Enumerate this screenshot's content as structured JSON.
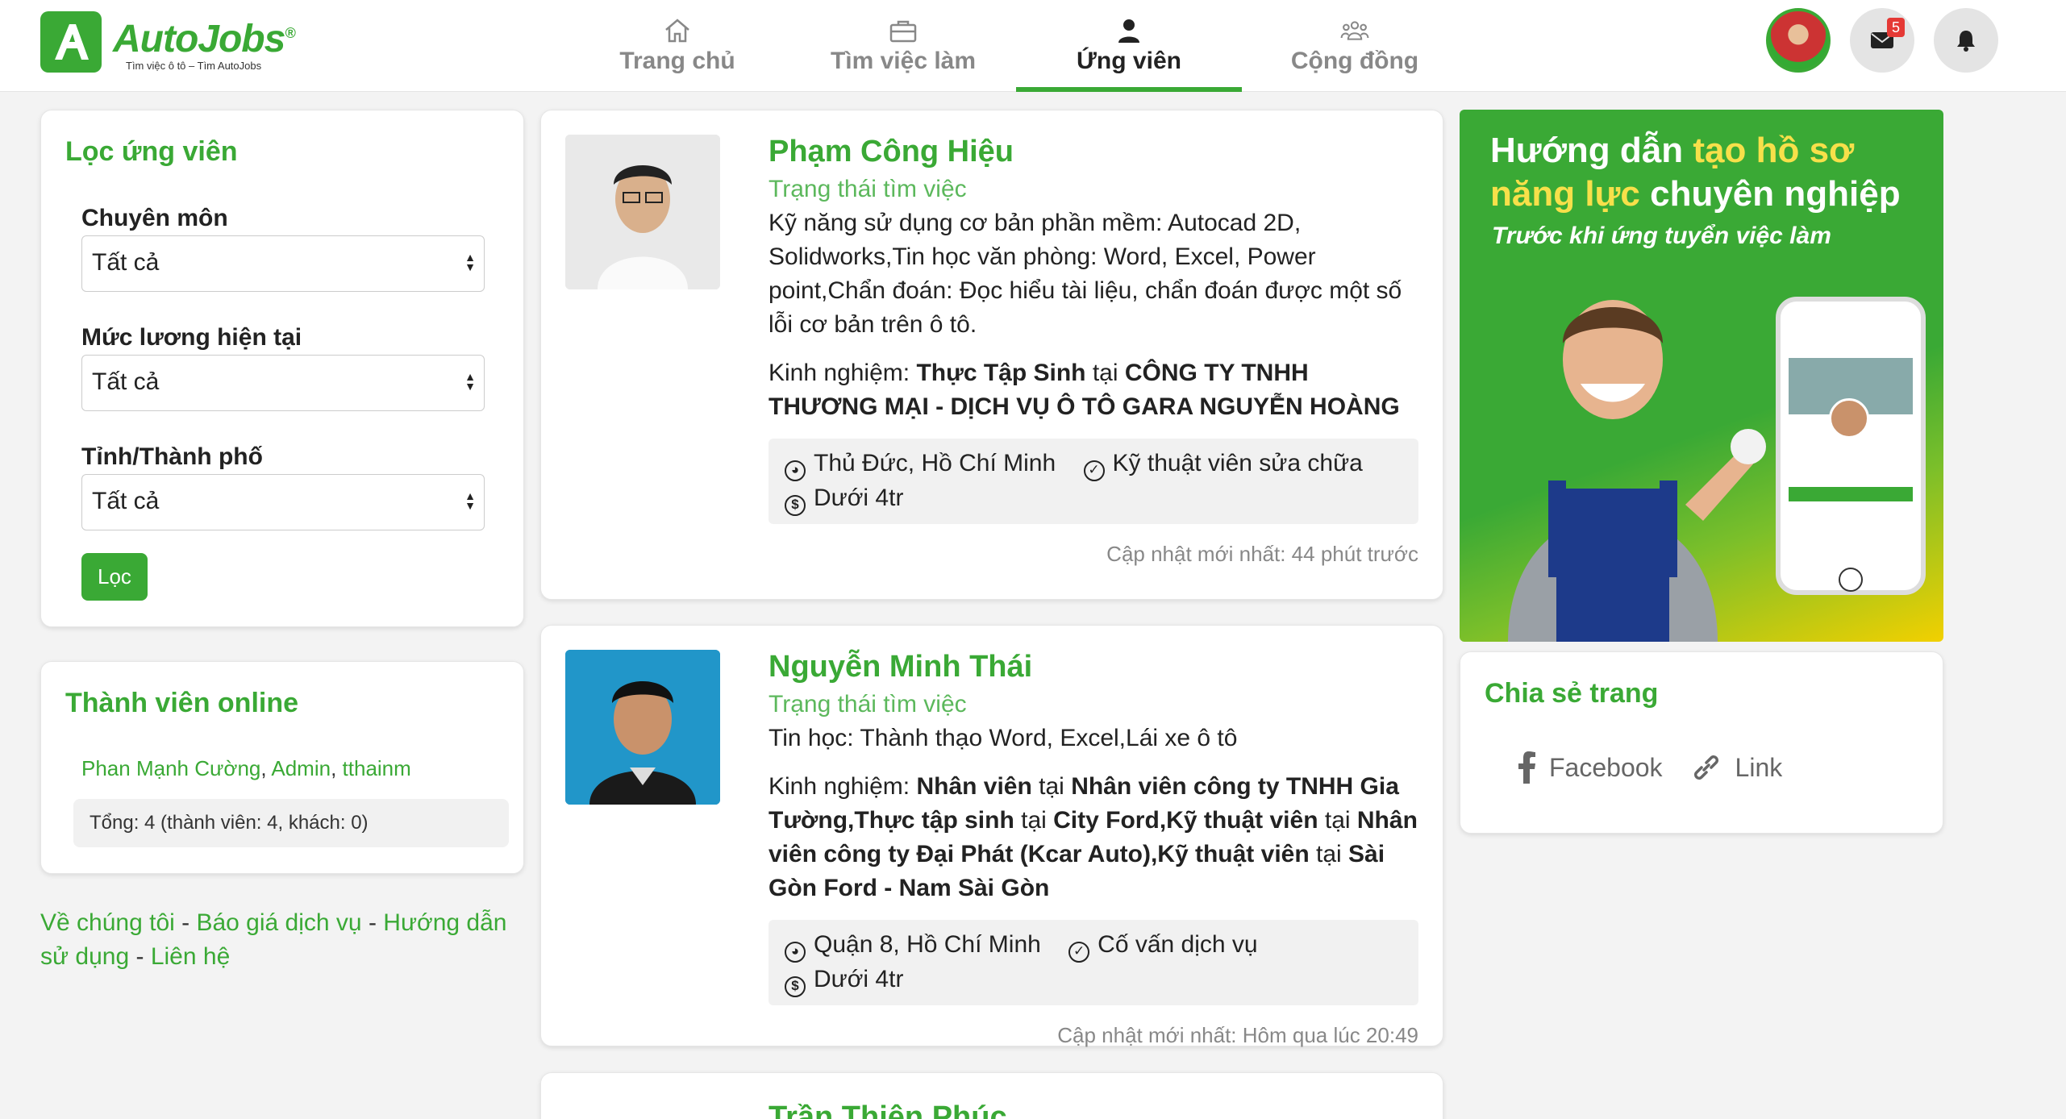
{
  "brand": {
    "name": "AutoJobs",
    "reg": "®",
    "tagline": "Tìm việc ô tô – Tìm AutoJobs"
  },
  "nav": [
    {
      "label": "Trang chủ",
      "icon": "home-icon"
    },
    {
      "label": "Tìm việc làm",
      "icon": "briefcase-icon"
    },
    {
      "label": "Ứng viên",
      "icon": "user-icon",
      "active": true
    },
    {
      "label": "Cộng đồng",
      "icon": "community-icon"
    }
  ],
  "header": {
    "message_badge": "5"
  },
  "filter": {
    "title": "Lọc ứng viên",
    "fields": [
      {
        "label": "Chuyên môn",
        "value": "Tất cả"
      },
      {
        "label": "Mức lương hiện tại",
        "value": "Tất cả"
      },
      {
        "label": "Tỉnh/Thành phố",
        "value": "Tất cả"
      }
    ],
    "button": "Lọc"
  },
  "online": {
    "title": "Thành viên online",
    "members": [
      "Phan Mạnh Cường",
      "Admin",
      "tthainm"
    ],
    "separator": ", ",
    "total": "Tổng: 4 (thành viên: 4, khách: 0)"
  },
  "footer": {
    "links": [
      "Về chúng tôi",
      "Báo giá dịch vụ",
      "Hướng dẫn sử dụng",
      "Liên hệ"
    ],
    "separator": " - "
  },
  "candidates": [
    {
      "name": "Phạm Công Hiệu",
      "status": "Trạng thái tìm việc",
      "desc": "Kỹ năng sử dụng cơ bản phần mềm: Autocad 2D, Solidworks,Tin học văn phòng: Word, Excel, Power point,Chẩn đoán: Đọc hiểu tài liệu, chẩn đoán được một số lỗi cơ bản trên ô tô.",
      "exp_prefix": "Kinh nghiệm: ",
      "exp_role": "Thực Tập Sinh",
      "exp_at": " tại ",
      "exp_company": "CÔNG TY TNHH THƯƠNG MẠI - DỊCH VỤ Ô TÔ GARA NGUYỄN HOÀNG",
      "location": "Thủ Đức, Hồ Chí Minh",
      "position": "Kỹ thuật viên sửa chữa",
      "salary": "Dưới 4tr",
      "updated": "Cập nhật mới nhất: 44 phút trước"
    },
    {
      "name": "Nguyễn Minh Thái",
      "status": "Trạng thái tìm việc",
      "desc": "Tin học: Thành thạo Word, Excel,Lái xe ô tô",
      "exp_prefix": "Kinh nghiệm: ",
      "exp_parts": [
        {
          "role": "Nhân viên",
          "at": " tại ",
          "company": "Nhân viên công ty TNHH Gia Tường"
        },
        {
          "role": "Thực tập sinh",
          "at": " tại ",
          "company": "City Ford"
        },
        {
          "role": "Kỹ thuật viên",
          "at": " tại ",
          "company": "Nhân viên công ty Đại Phát (Kcar Auto)"
        },
        {
          "role": "Kỹ thuật viên",
          "at": " tại ",
          "company": "Sài Gòn Ford - Nam Sài Gòn"
        }
      ],
      "location": "Quận 8, Hồ Chí Minh",
      "position": "Cố vấn dịch vụ",
      "salary": "Dưới 4tr",
      "updated": "Cập nhật mới nhất: Hôm qua lúc 20:49"
    },
    {
      "name": "Trần Thiện Phúc"
    }
  ],
  "promo": {
    "line1_a": "Hướng dẫn ",
    "line1_b": "tạo hồ sơ",
    "line2_a": "năng lực",
    "line2_b": " chuyên nghiệp",
    "subtitle": "Trước khi ứng tuyển việc làm"
  },
  "share": {
    "title": "Chia sẻ trang",
    "facebook": "Facebook",
    "link": "Link"
  },
  "colors": {
    "accent": "#3aa935",
    "badge": "#e53935",
    "highlight": "#f7e04a"
  }
}
